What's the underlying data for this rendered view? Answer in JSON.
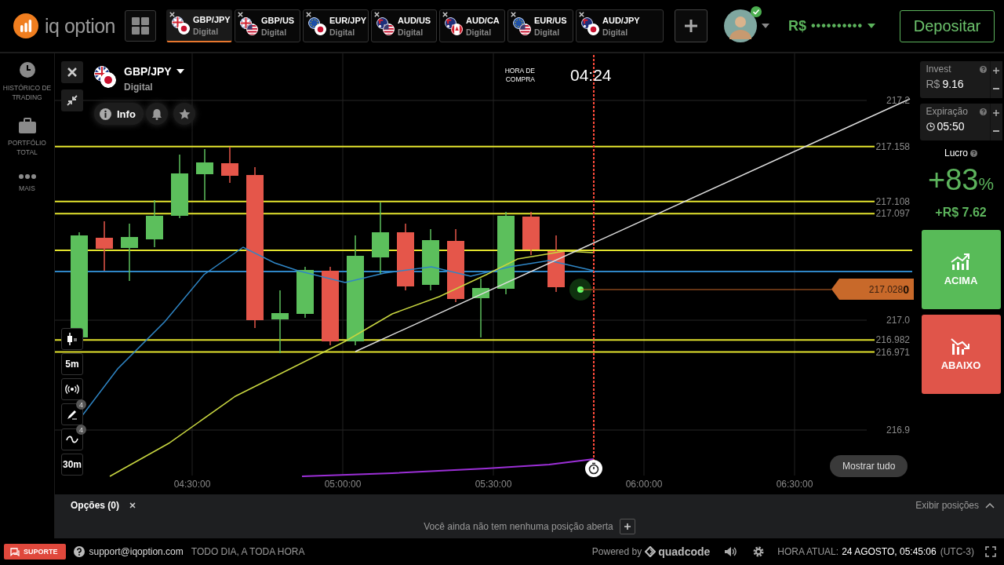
{
  "header": {
    "logo": "iq option",
    "tabs": [
      {
        "pair": "GBP/JPY",
        "type": "Digital",
        "selected": true
      },
      {
        "pair": "GBP/US",
        "type": "Digital",
        "selected": false
      },
      {
        "pair": "EUR/JPY",
        "type": "Digital",
        "selected": false
      },
      {
        "pair": "AUD/US",
        "type": "Digital",
        "selected": false
      },
      {
        "pair": "AUD/CA",
        "type": "Digital",
        "selected": false
      },
      {
        "pair": "EUR/US",
        "type": "Digital",
        "selected": false
      },
      {
        "pair": "AUD/JPY",
        "type": "Digital",
        "selected": false
      }
    ],
    "balance": {
      "currency": "R$",
      "masked": "••••••••••"
    },
    "deposit_button": "Depositar"
  },
  "sidebar": {
    "items": [
      {
        "label": "HISTÓRICO DE TRADING",
        "kind": "history"
      },
      {
        "label": "PORTFÓLIO TOTAL",
        "kind": "portfolio"
      },
      {
        "label": "MAIS",
        "kind": "more"
      }
    ]
  },
  "chart": {
    "asset": "GBP/JPY",
    "asset_type": "Digital",
    "info_button": "Info",
    "purchase_time_label": "HORA DE COMPRA",
    "purchase_time": "04:24",
    "price_levels": [
      {
        "label": "217.2",
        "kind": "grid"
      },
      {
        "label": "217.158",
        "kind": "level"
      },
      {
        "label": "217.108",
        "kind": "level"
      },
      {
        "label": "217.097",
        "kind": "level"
      },
      {
        "label": "217.0",
        "kind": "grid"
      },
      {
        "label": "216.982",
        "kind": "level"
      },
      {
        "label": "216.971",
        "kind": "level"
      },
      {
        "label": "216.9",
        "kind": "grid"
      }
    ],
    "current_price": "217.028**0**",
    "time_ticks": [
      "04:30:00",
      "05:00:00",
      "05:30:00",
      "06:00:00",
      "06:30:00"
    ],
    "tools": [
      {
        "kind": "candles"
      },
      {
        "kind": "text",
        "label": "5m"
      },
      {
        "kind": "signal"
      },
      {
        "kind": "pencil",
        "badge": "4"
      },
      {
        "kind": "wave",
        "badge": "4"
      },
      {
        "kind": "text",
        "label": "30m"
      }
    ],
    "show_all_button": "Mostrar tudo"
  },
  "trade_panel": {
    "invest": {
      "label": "Invest",
      "currency": "R$",
      "value": "9.16"
    },
    "expiration": {
      "label": "Expiração",
      "value": "05:50"
    },
    "profit_label": "Lucro",
    "profit_percent": "+83",
    "percent_sign": "%",
    "profit_amount": "+R$ 7.62",
    "buttons": [
      {
        "label": "ACIMA",
        "kind": "up"
      },
      {
        "label": "ABAIXO",
        "kind": "down"
      }
    ]
  },
  "options_panel": {
    "title": "Opções (0)",
    "show_positions": "Exibir posições",
    "empty_message": "Você ainda não tem nenhuma posição aberta"
  },
  "footer": {
    "support_button": "SUPORTE",
    "email": "support@iqoption.com",
    "hours": "TODO DIA, A TODA HORA",
    "powered_by": "Powered by",
    "brand": "quadcode",
    "time_label": "HORA ATUAL:",
    "time_value": "24 AGOSTO, 05:45:06",
    "timezone": "(UTC-3)"
  }
}
